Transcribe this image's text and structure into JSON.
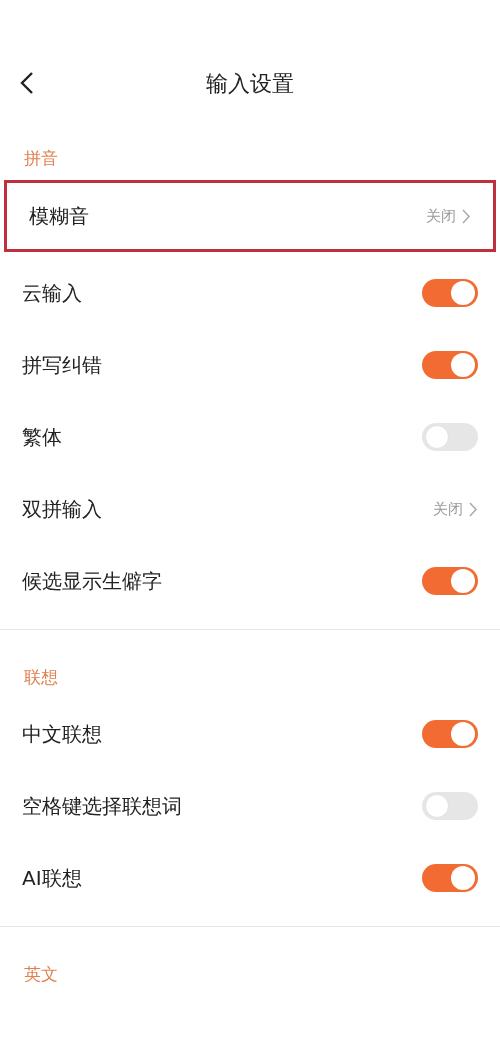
{
  "header": {
    "title": "输入设置"
  },
  "sections": [
    {
      "title": "拼音",
      "rows": [
        {
          "kind": "link",
          "label": "模糊音",
          "value": "关闭",
          "highlighted": true
        },
        {
          "kind": "switch",
          "label": "云输入",
          "on": true,
          "highlighted": false
        },
        {
          "kind": "switch",
          "label": "拼写纠错",
          "on": true,
          "highlighted": false
        },
        {
          "kind": "switch",
          "label": "繁体",
          "on": false,
          "highlighted": false
        },
        {
          "kind": "link",
          "label": "双拼输入",
          "value": "关闭",
          "highlighted": false
        },
        {
          "kind": "switch",
          "label": "候选显示生僻字",
          "on": true,
          "highlighted": false
        }
      ]
    },
    {
      "title": "联想",
      "rows": [
        {
          "kind": "switch",
          "label": "中文联想",
          "on": true,
          "highlighted": false
        },
        {
          "kind": "switch",
          "label": "空格键选择联想词",
          "on": false,
          "highlighted": false
        },
        {
          "kind": "switch",
          "label": "AI联想",
          "on": true,
          "highlighted": false
        }
      ]
    },
    {
      "title": "英文"
    }
  ]
}
